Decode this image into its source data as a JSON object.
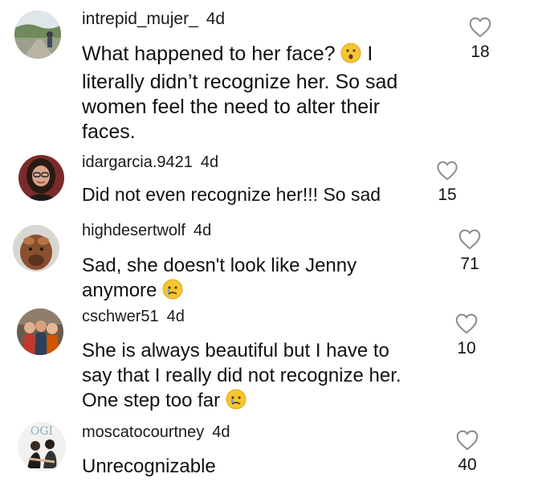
{
  "comments": [
    {
      "username": "intrepid_mujer_",
      "time": "4d",
      "text_lines": [
        "What happened to her face?",
        "literally didn’t recognize her. So sad",
        "women feel the need to alter  their",
        "faces."
      ],
      "inline_emoji": "hushed-face-emoji",
      "text_after_emoji": " I",
      "likes": "18",
      "avatar": "outdoor-bike-photo"
    },
    {
      "username": "idargarcia.9421",
      "time": "4d",
      "text_lines": [
        "Did not even recognize her!!! So sad"
      ],
      "likes": "15",
      "avatar": "woman-with-glasses-photo"
    },
    {
      "username": "highdesertwolf",
      "time": "4d",
      "text_lines": [
        "Sad, she doesn't look like Jenny",
        "anymore"
      ],
      "trailing_emoji": "crying-face-emoji",
      "likes": "71",
      "avatar": "highland-cow-photo"
    },
    {
      "username": "cschwer51",
      "time": "4d",
      "text_lines": [
        "She is always beautiful but I have to",
        "say that I really did not recognize her.",
        "One step too far"
      ],
      "trailing_emoji": "crying-face-emoji",
      "likes": "10",
      "avatar": "group-photo"
    },
    {
      "username": "moscatocourtney",
      "time": "4d",
      "text_lines": [
        "Unrecognizable"
      ],
      "likes": "40",
      "avatar": "magazine-cover-photo",
      "avatar_text": "OGI"
    }
  ],
  "colors": {
    "text": "#111111",
    "heart_outline": "#8e8e8e",
    "emoji_yellow": "#f7c531"
  }
}
